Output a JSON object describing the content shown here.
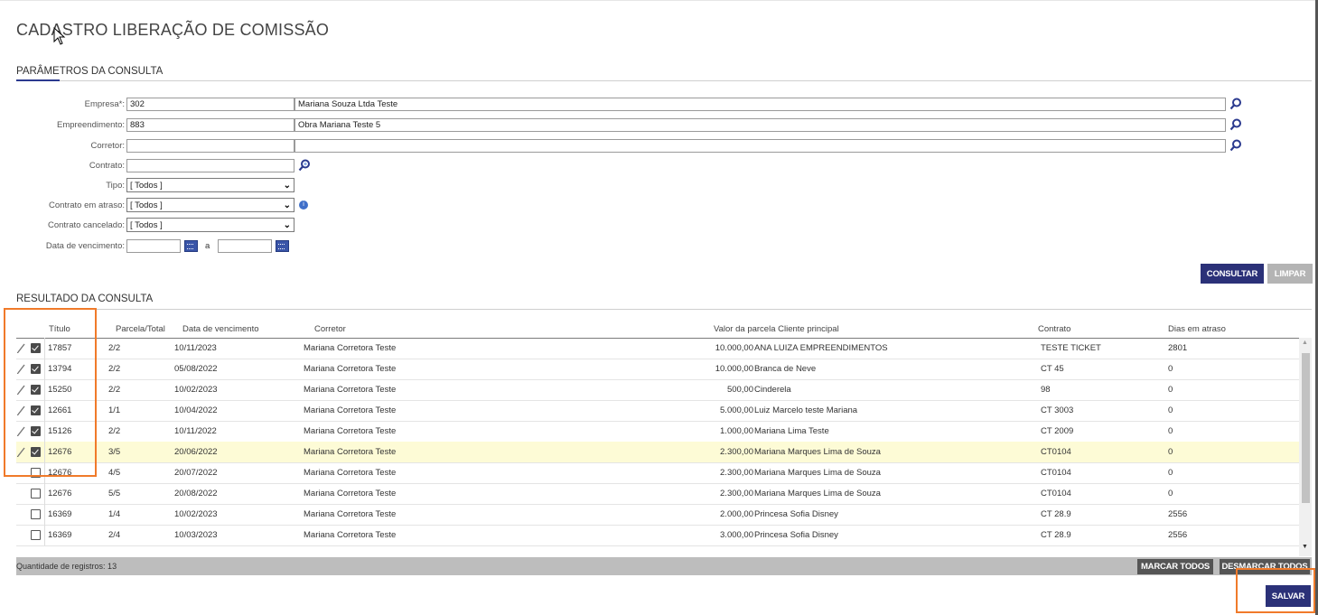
{
  "page": {
    "title": "CADASTRO LIBERAÇÃO DE COMISSÃO"
  },
  "params": {
    "section_title": "PARÂMETROS DA CONSULTA",
    "empresa": {
      "label": "Empresa*:",
      "code": "302",
      "name": "Mariana Souza Ltda Teste"
    },
    "empreendimento": {
      "label": "Empreendimento:",
      "code": "883",
      "name": "Obra Mariana Teste 5"
    },
    "corretor": {
      "label": "Corretor:",
      "code": "",
      "name": ""
    },
    "contrato": {
      "label": "Contrato:",
      "value": ""
    },
    "tipo": {
      "label": "Tipo:",
      "selected": "[ Todos ]"
    },
    "contrato_atraso": {
      "label": "Contrato em atraso:",
      "selected": "[ Todos ]"
    },
    "contrato_cancelado": {
      "label": "Contrato cancelado:",
      "selected": "[ Todos ]"
    },
    "data_vencimento": {
      "label": "Data de vencimento:",
      "from": "",
      "separator": "a",
      "to": ""
    }
  },
  "actions": {
    "consultar": "CONSULTAR",
    "limpar": "LIMPAR"
  },
  "results": {
    "section_title": "RESULTADO DA CONSULTA",
    "columns": {
      "titulo": "Título",
      "parcela": "Parcela/Total",
      "vencimento": "Data de vencimento",
      "corretor": "Corretor",
      "valor_cliente": "Valor da parcela Cliente principal",
      "contrato": "Contrato",
      "dias": "Dias em atraso"
    },
    "rows": [
      {
        "editable": true,
        "checked": true,
        "titulo": "17857",
        "parcela": "2/2",
        "vencimento": "10/11/2023",
        "corretor": "Mariana Corretora Teste",
        "valor": "10.000,00",
        "cliente": "ANA LUIZA EMPREENDIMENTOS",
        "contrato": "TESTE TICKET",
        "dias": "2801"
      },
      {
        "editable": true,
        "checked": true,
        "titulo": "13794",
        "parcela": "2/2",
        "vencimento": "05/08/2022",
        "corretor": "Mariana Corretora Teste",
        "valor": "10.000,00",
        "cliente": "Branca de Neve",
        "contrato": "CT 45",
        "dias": "0"
      },
      {
        "editable": true,
        "checked": true,
        "titulo": "15250",
        "parcela": "2/2",
        "vencimento": "10/02/2023",
        "corretor": "Mariana Corretora Teste",
        "valor": "500,00",
        "cliente": "Cinderela",
        "contrato": "98",
        "dias": "0"
      },
      {
        "editable": true,
        "checked": true,
        "titulo": "12661",
        "parcela": "1/1",
        "vencimento": "10/04/2022",
        "corretor": "Mariana Corretora Teste",
        "valor": "5.000,00",
        "cliente": "Luiz Marcelo teste Mariana",
        "contrato": "CT 3003",
        "dias": "0"
      },
      {
        "editable": true,
        "checked": true,
        "titulo": "15126",
        "parcela": "2/2",
        "vencimento": "10/11/2022",
        "corretor": "Mariana Corretora Teste",
        "valor": "1.000,00",
        "cliente": "Mariana Lima Teste",
        "contrato": "CT 2009",
        "dias": "0"
      },
      {
        "editable": true,
        "checked": true,
        "titulo": "12676",
        "parcela": "3/5",
        "vencimento": "20/06/2022",
        "corretor": "Mariana Corretora Teste",
        "valor": "2.300,00",
        "cliente": "Mariana Marques Lima de Souza",
        "contrato": "CT0104",
        "dias": "0",
        "highlight": true
      },
      {
        "editable": false,
        "checked": false,
        "titulo": "12676",
        "parcela": "4/5",
        "vencimento": "20/07/2022",
        "corretor": "Mariana Corretora Teste",
        "valor": "2.300,00",
        "cliente": "Mariana Marques Lima de Souza",
        "contrato": "CT0104",
        "dias": "0"
      },
      {
        "editable": false,
        "checked": false,
        "titulo": "12676",
        "parcela": "5/5",
        "vencimento": "20/08/2022",
        "corretor": "Mariana Corretora Teste",
        "valor": "2.300,00",
        "cliente": "Mariana Marques Lima de Souza",
        "contrato": "CT0104",
        "dias": "0"
      },
      {
        "editable": false,
        "checked": false,
        "titulo": "16369",
        "parcela": "1/4",
        "vencimento": "10/02/2023",
        "corretor": "Mariana Corretora Teste",
        "valor": "2.000,00",
        "cliente": "Princesa Sofia Disney",
        "contrato": "CT 28.9",
        "dias": "2556"
      },
      {
        "editable": false,
        "checked": false,
        "titulo": "16369",
        "parcela": "2/4",
        "vencimento": "10/03/2023",
        "corretor": "Mariana Corretora Teste",
        "valor": "3.000,00",
        "cliente": "Princesa Sofia Disney",
        "contrato": "CT 28.9",
        "dias": "2556"
      }
    ],
    "record_count": "Quantidade de registros: 13",
    "marcar_todos": "MARCAR TODOS",
    "desmarcar_todos": "DESMARCAR TODOS"
  },
  "save": {
    "label": "SALVAR"
  },
  "colors": {
    "primary": "#2b3178",
    "highlight_row": "#fdfbd6",
    "annotation": "#f07a2a"
  }
}
